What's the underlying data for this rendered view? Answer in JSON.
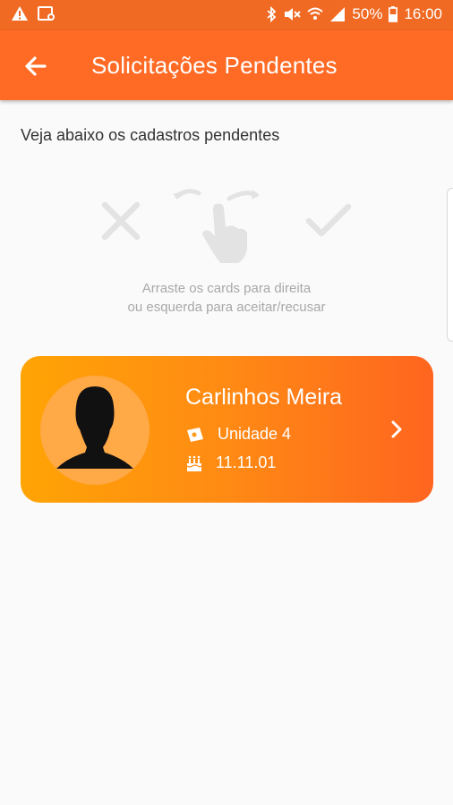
{
  "statusbar": {
    "battery": "50%",
    "time": "16:00"
  },
  "appbar": {
    "title": "Solicitações Pendentes"
  },
  "page": {
    "subtitle": "Veja abaixo os cadastros pendentes",
    "hint_line1": "Arraste os cards para direita",
    "hint_line2": "ou esquerda para aceitar/recusar"
  },
  "card": {
    "name": "Carlinhos Meira",
    "unit": "Unidade 4",
    "date": "11.11.01"
  },
  "colors": {
    "statusbar": "#f06a23",
    "appbar": "#ff6a24",
    "card_start": "#ffa405",
    "card_end": "#ff651f",
    "hint_gray": "#e3e3e3"
  },
  "icons": [
    "warning-icon",
    "image-icon",
    "bluetooth-icon",
    "mute-icon",
    "wifi-icon",
    "signal-icon",
    "battery-icon",
    "back-arrow-icon",
    "reject-x-icon",
    "swipe-hand-icon",
    "accept-check-icon",
    "ticket-icon",
    "cake-icon",
    "chevron-right-icon",
    "avatar-silhouette-icon"
  ]
}
